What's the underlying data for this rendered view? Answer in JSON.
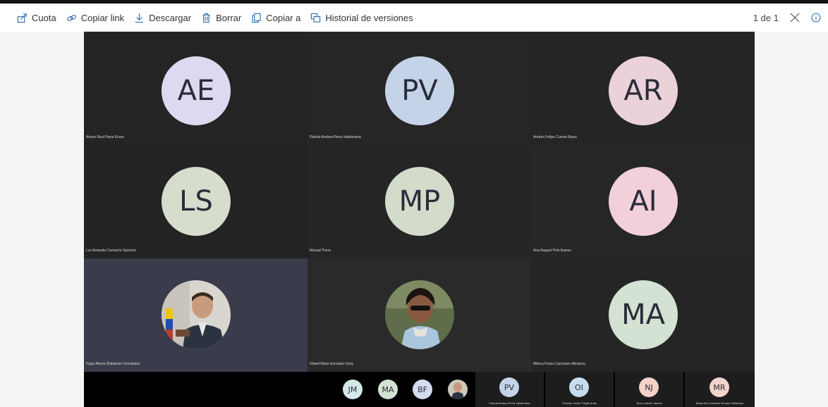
{
  "toolbar": {
    "items": [
      {
        "label": "Cuota",
        "icon": "share-icon"
      },
      {
        "label": "Copiar link",
        "icon": "link-icon"
      },
      {
        "label": "Descargar",
        "icon": "download-icon"
      },
      {
        "label": "Borrar",
        "icon": "trash-icon"
      },
      {
        "label": "Copiar a",
        "icon": "copy-icon"
      },
      {
        "label": "Historial de versiones",
        "icon": "history-icon"
      }
    ],
    "page_indicator": "1 de 1"
  },
  "participants": [
    {
      "initials": "AE",
      "name": "Alvaro Raul Parra Erazo",
      "color": "#dcdaf0"
    },
    {
      "initials": "PV",
      "name": "Pahola Andrea Pena Valderrama",
      "color": "#c5d3e8"
    },
    {
      "initials": "AR",
      "name": "Andres Felipe Currea Rojas",
      "color": "#ebd2d9"
    },
    {
      "initials": "LS",
      "name": "Luz Amanda Camacho Sanchez",
      "color": "#d6ddcd"
    },
    {
      "initials": "MP",
      "name": "Manuel Parra",
      "color": "#d3dccb"
    },
    {
      "initials": "AI",
      "name": "Ana Raquel Polo Ibanez",
      "color": "#f1d0d9"
    },
    {
      "initials": "",
      "name": "Hugo Alonso Bahamon Fernandez",
      "color": "#3a3c4c"
    },
    {
      "initials": "",
      "name": "Ghisel Alicia Gonzalez Grey",
      "color": "#2b2b2b"
    },
    {
      "initials": "MA",
      "name": "Milena Paola Canchano Almanza",
      "color": "#d4e2d4"
    }
  ],
  "strip_avatars": [
    {
      "initials": "JM",
      "color": "#d4e8ea"
    },
    {
      "initials": "MA",
      "color": "#d3e3d3"
    },
    {
      "initials": "BF",
      "color": "#d3ddef"
    }
  ],
  "strip_named": [
    {
      "initials": "PV",
      "name": "Pahola Andrea Pena Valderrama",
      "color": "#c5d3e8"
    },
    {
      "initials": "OI",
      "name": "Orlando Javier Trujillo Iruita",
      "color": "#c7ddee"
    },
    {
      "initials": "NJ",
      "name": "Nury Lizbeth Jaimes",
      "color": "#f4d2c6"
    },
    {
      "initials": "MR",
      "name": "Maria del Consuelo Romero Restrepo",
      "color": "#f3d3cc"
    }
  ]
}
